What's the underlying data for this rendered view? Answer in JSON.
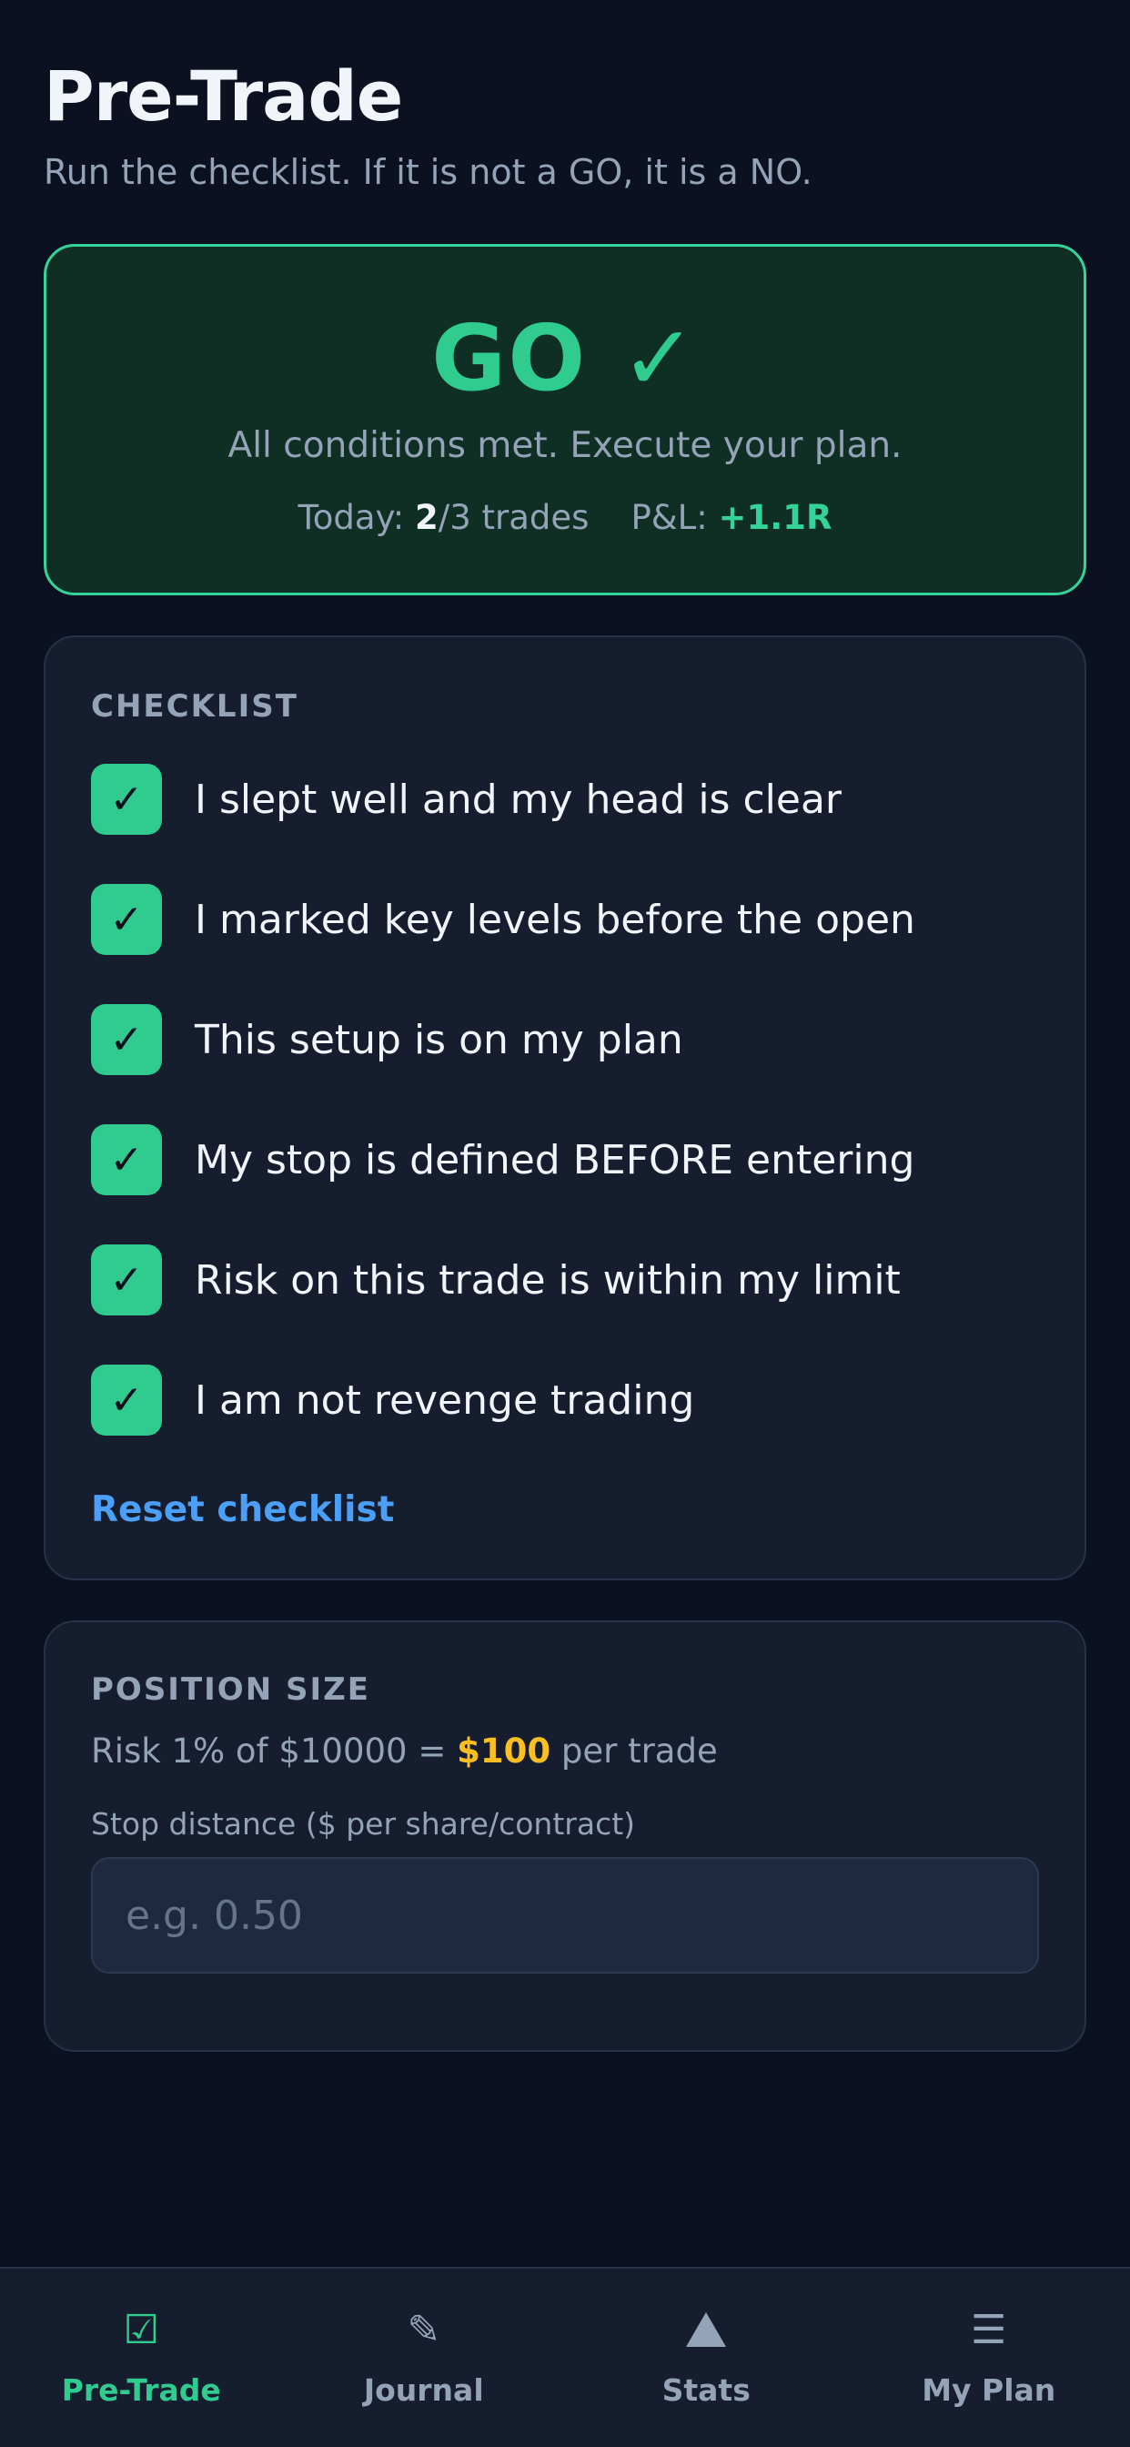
{
  "header": {
    "title": "Pre-Trade",
    "subtitle": "Run the checklist. If it is not a GO, it is a NO."
  },
  "status": {
    "verdict": "GO ✓",
    "message": "All conditions met. Execute your plan.",
    "today_label": "Today: ",
    "trades_done": "2",
    "trades_suffix": "/3 trades",
    "pnl_label": "P&L: ",
    "pnl_value": "+1.1R",
    "accent_color": "#34d399"
  },
  "checklist": {
    "label": "CHECKLIST",
    "items": [
      {
        "text": "I slept well and my head is clear",
        "checked": true
      },
      {
        "text": "I marked key levels before the open",
        "checked": true
      },
      {
        "text": "This setup is on my plan",
        "checked": true
      },
      {
        "text": "My stop is defined BEFORE entering",
        "checked": true
      },
      {
        "text": "Risk on this trade is within my limit",
        "checked": true
      },
      {
        "text": "I am not revenge trading",
        "checked": true
      }
    ],
    "check_glyph": "✓",
    "reset_label": "Reset checklist"
  },
  "position": {
    "label": "POSITION SIZE",
    "risk_prefix": "Risk 1% of $10000 = ",
    "risk_amount": "$100",
    "risk_suffix": " per trade",
    "stop_label": "Stop distance ($ per share/contract)",
    "stop_value": "",
    "stop_placeholder": "e.g. 0.50"
  },
  "nav": {
    "items": [
      {
        "label": "Pre-Trade",
        "icon": "checkbox-icon",
        "glyph": "☑",
        "active": true
      },
      {
        "label": "Journal",
        "icon": "pencil-icon",
        "glyph": "✎",
        "active": false
      },
      {
        "label": "Stats",
        "icon": "triangle-icon",
        "glyph": "",
        "active": false
      },
      {
        "label": "My Plan",
        "icon": "menu-icon",
        "glyph": "☰",
        "active": false
      }
    ]
  }
}
